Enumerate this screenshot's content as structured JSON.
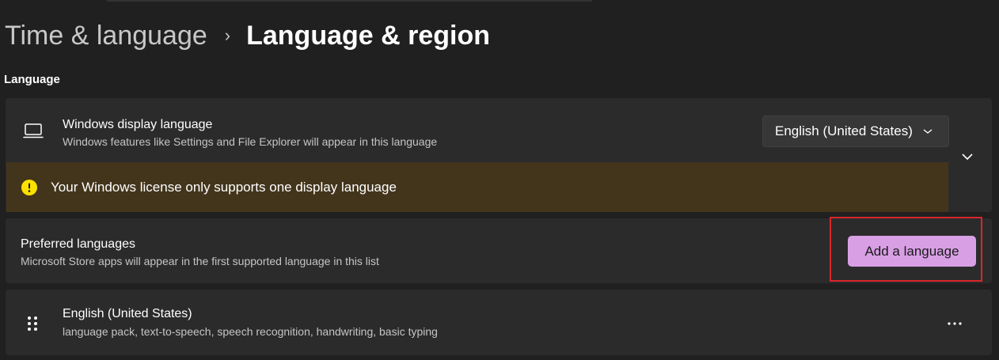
{
  "breadcrumb": {
    "parent": "Time & language",
    "separator": "›",
    "current": "Language & region"
  },
  "section": {
    "label": "Language"
  },
  "display_language": {
    "title": "Windows display language",
    "subtitle": "Windows features like Settings and File Explorer will appear in this language",
    "selected": "English (United States)",
    "icon": "monitor-icon",
    "warning": "Your Windows license only supports one display language",
    "warning_color": "#fce100"
  },
  "preferred": {
    "title": "Preferred languages",
    "subtitle": "Microsoft Store apps will appear in the first supported language in this list",
    "add_button": "Add a language",
    "accent": "#d89fe5"
  },
  "languages": [
    {
      "name": "English (United States)",
      "features": "language pack, text-to-speech, speech recognition, handwriting, basic typing"
    }
  ]
}
